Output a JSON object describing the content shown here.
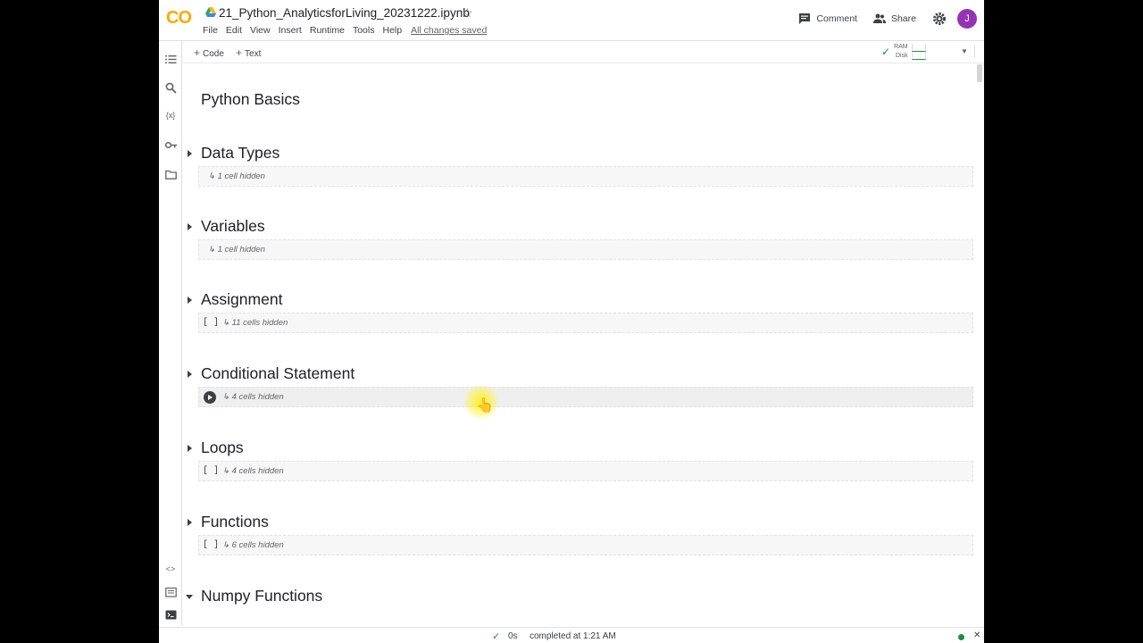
{
  "header": {
    "logo": "CO",
    "title": "21_Python_AnalyticsforLiving_20231222.ipynb",
    "menu": [
      "File",
      "Edit",
      "View",
      "Insert",
      "Runtime",
      "Tools",
      "Help"
    ],
    "saved_status": "All changes saved",
    "comment_label": "Comment",
    "share_label": "Share",
    "avatar_initial": "J",
    "avatar_color": "#9334b5"
  },
  "toolbar": {
    "code_label": "Code",
    "text_label": "Text",
    "ram_label": "RAM",
    "disk_label": "Disk"
  },
  "notebook": {
    "title": "Python Basics",
    "sections": [
      {
        "heading": "Data Types",
        "hidden": "1 cell hidden",
        "run_state": "none"
      },
      {
        "heading": "Variables",
        "hidden": "1 cell hidden",
        "run_state": "none"
      },
      {
        "heading": "Assignment",
        "hidden": "11 cells hidden",
        "run_state": "bracket"
      },
      {
        "heading": "Conditional Statement",
        "hidden": "4 cells hidden",
        "run_state": "play"
      },
      {
        "heading": "Loops",
        "hidden": "4 cells hidden",
        "run_state": "bracket"
      },
      {
        "heading": "Functions",
        "hidden": "6 cells hidden",
        "run_state": "bracket"
      },
      {
        "heading": "Numpy Functions",
        "expanded": true
      }
    ]
  },
  "status": {
    "exec_time": "0s",
    "completed": "completed at 1:21 AM"
  },
  "colors": {
    "accent_green": "#1e8e3e",
    "logo_orange": "#f9ab00"
  }
}
